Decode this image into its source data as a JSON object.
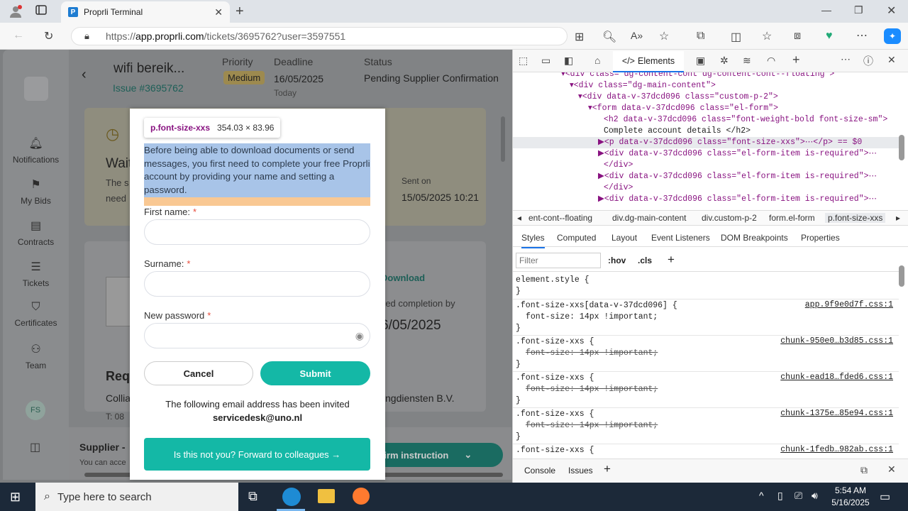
{
  "browser": {
    "tab_title": "Proprli Terminal",
    "url_prefix": "https://",
    "url_domain": "app.proprli.com",
    "url_path": "/tickets/3695762?user=3597551"
  },
  "sidebar": {
    "items": [
      {
        "label": "Notifications"
      },
      {
        "label": "My Bids"
      },
      {
        "label": "Contracts"
      },
      {
        "label": "Tickets"
      },
      {
        "label": "Certificates"
      },
      {
        "label": "Team"
      }
    ],
    "avatar": "FS"
  },
  "ticket": {
    "title": "wifi bereik...",
    "issue": "Issue #3695762",
    "priority_label": "Priority",
    "priority": "Medium",
    "deadline_label": "Deadline",
    "deadline": "16/05/2025",
    "deadline_sub": "Today",
    "status_label": "Status",
    "status": "Pending Supplier Confirmation",
    "wait_text": "Wait",
    "body_fragment": "The s",
    "body_fragment2": "need",
    "sent_on_label": "Sent on",
    "sent_on": "15/05/2025 10:21",
    "download": "Download",
    "completion_text": "red completion by",
    "completion_date": "6/05/2025",
    "req_heading": "Req",
    "company_left": "Collia",
    "company_right": "ngdiensten B.V.",
    "phone_fragment": "T: 08",
    "supplier_label": "Supplier -",
    "supplier_sub": "You can acce",
    "confirm_button": "firm instruction"
  },
  "modal": {
    "heading_fragment": "ails",
    "tooltip_class": "p.font-size-xxs",
    "tooltip_size": "354.03 × 83.96",
    "intro": "Before being able to download documents or send messages, you first need to complete your free Proprli account by providing your name and setting a password.",
    "first_name_label": "First name:",
    "surname_label": "Surname:",
    "password_label": "New password",
    "required_mark": "*",
    "cancel": "Cancel",
    "submit": "Submit",
    "invited_text": "The following email address has been invited",
    "email": "servicedesk@uno.nl",
    "forward": "Is this not you? Forward to colleagues →"
  },
  "devtools": {
    "tab_elements": "Elements",
    "dom_lines": [
      {
        "indent": 5,
        "html": "▾<div class=\"dg-content-cont dg-content-cont--floating\">"
      },
      {
        "indent": 6,
        "html": "▾<div class=\"dg-main-content\">"
      },
      {
        "indent": 7,
        "html": "▾<div data-v-37dcd096 class=\"custom-p-2\">"
      },
      {
        "indent": 8,
        "html": "▾<form data-v-37dcd096 class=\"el-form\">"
      },
      {
        "indent": 9,
        "html": "<h2 data-v-37dcd096 class=\"font-weight-bold font-size-sm\">"
      },
      {
        "indent": 9,
        "html": "Complete account details </h2>"
      },
      {
        "indent": 9,
        "html": "▶<p data-v-37dcd096 class=\"font-size-xxs\">⋯</p> == $0"
      },
      {
        "indent": 9,
        "html": "▶<div data-v-37dcd096 class=\"el-form-item is-required\">⋯"
      },
      {
        "indent": 9,
        "html": "</div>"
      },
      {
        "indent": 9,
        "html": "▶<div data-v-37dcd096 class=\"el-form-item is-required\">⋯"
      },
      {
        "indent": 9,
        "html": "</div>"
      },
      {
        "indent": 9,
        "html": "▶<div data-v-37dcd096 class=\"el-form-item is-required\">⋯"
      }
    ],
    "breadcrumbs": [
      "ent-cont--floating",
      "div.dg-main-content",
      "div.custom-p-2",
      "form.el-form",
      "p.font-size-xxs"
    ],
    "style_tabs": [
      "Styles",
      "Computed",
      "Layout",
      "Event Listeners",
      "DOM Breakpoints",
      "Properties"
    ],
    "filter_placeholder": "Filter",
    "hov": ":hov",
    "cls": ".cls",
    "rules": [
      {
        "selector": "element.style {",
        "prop": "",
        "close": "}",
        "source": "",
        "struck": false
      },
      {
        "selector": ".font-size-xxs[data-v-37dcd096] {",
        "prop": "font-size: 14px !important;",
        "close": "}",
        "source": "app.9f9e0d7f.css:1",
        "struck": false
      },
      {
        "selector": ".font-size-xxs {",
        "prop": "font-size: 14px !important;",
        "close": "}",
        "source": "chunk-950e0…b3d85.css:1",
        "struck": true
      },
      {
        "selector": ".font-size-xxs {",
        "prop": "font-size: 14px !important;",
        "close": "}",
        "source": "chunk-ead18…fded6.css:1",
        "struck": true
      },
      {
        "selector": ".font-size-xxs {",
        "prop": "font-size: 14px !important;",
        "close": "}",
        "source": "chunk-1375e…85e94.css:1",
        "struck": true
      },
      {
        "selector": ".font-size-xxs {",
        "prop": "",
        "close": "",
        "source": "chunk-1fedb…982ab.css:1",
        "struck": false
      }
    ],
    "drawer_tabs": [
      "Console",
      "Issues"
    ]
  },
  "taskbar": {
    "search_placeholder": "Type here to search",
    "time": "5:54 AM",
    "date": "5/16/2025"
  },
  "colors": {
    "teal": "#14b8a6",
    "medium_badge": "#f4c84e"
  }
}
